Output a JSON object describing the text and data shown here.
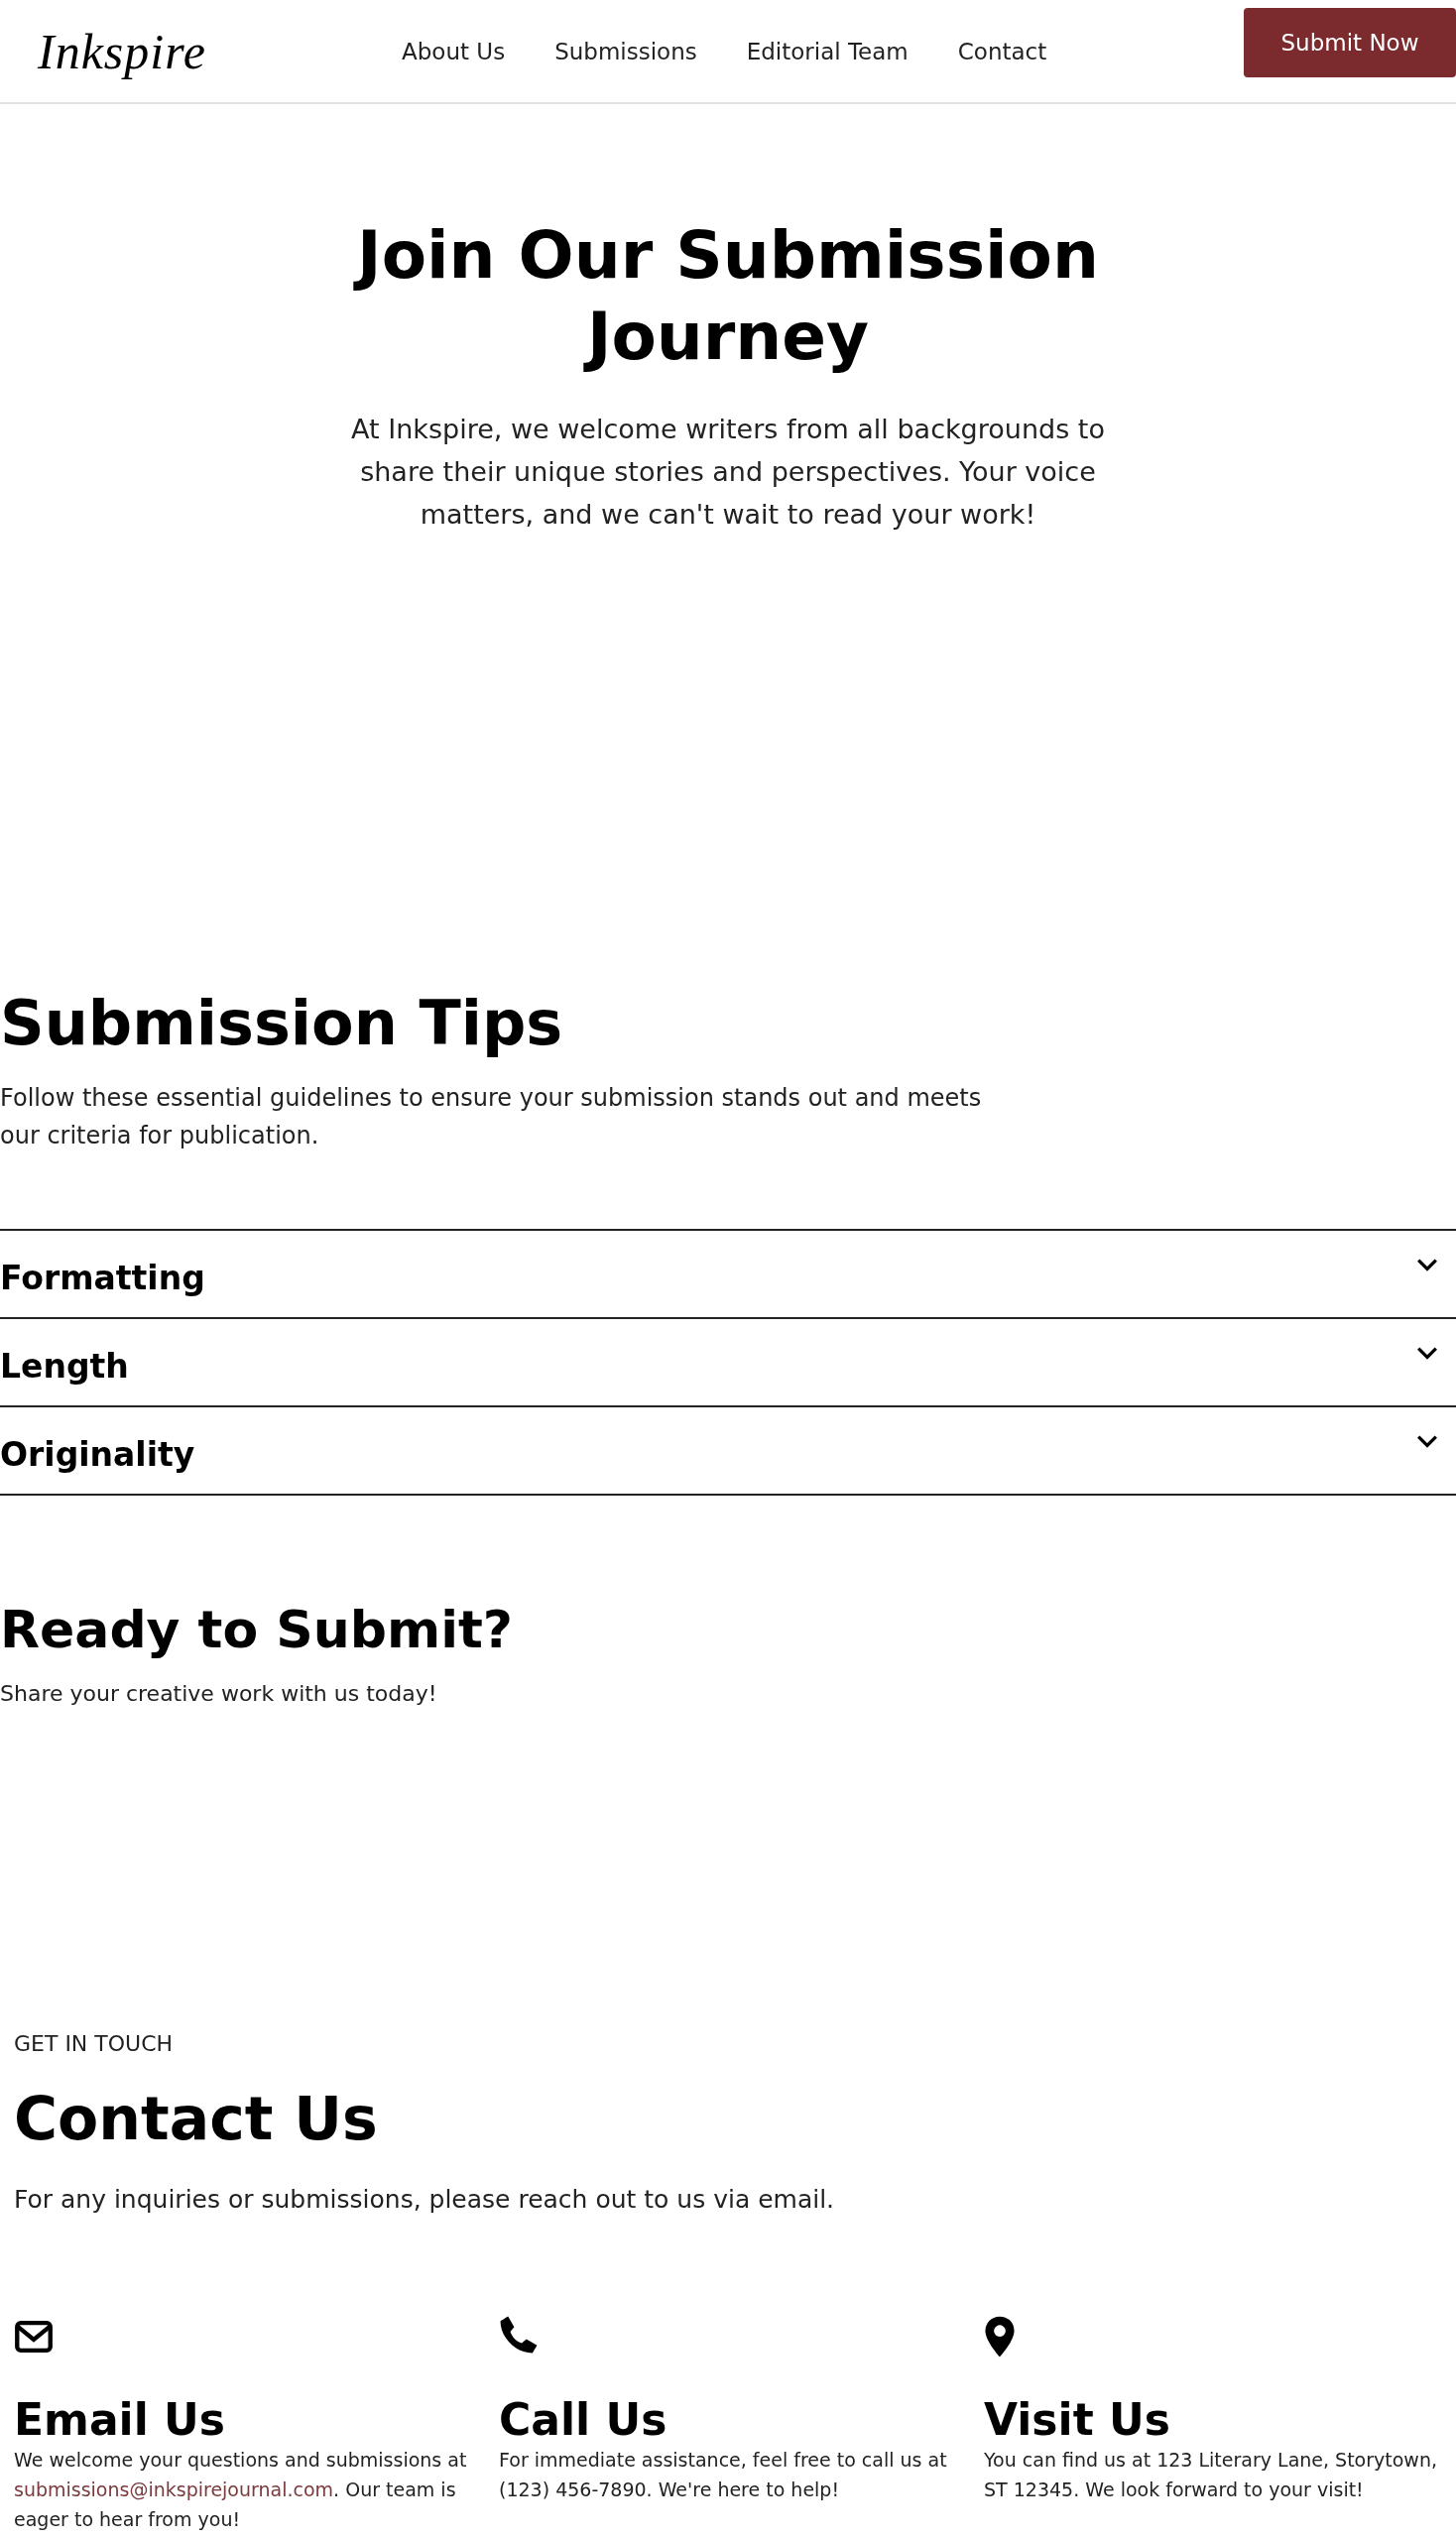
{
  "header": {
    "logo": "Inkspire",
    "nav": [
      "About Us",
      "Submissions",
      "Editorial Team",
      "Contact"
    ],
    "cta": "Submit Now"
  },
  "hero": {
    "title": "Join Our Submission Journey",
    "text": "At Inkspire, we welcome writers from all backgrounds to share their unique stories and perspectives. Your voice matters, and we can't wait to read your work!"
  },
  "tips": {
    "title": "Submission Tips",
    "text": "Follow these essential guidelines to ensure your submission stands out and meets our criteria for publication.",
    "items": [
      {
        "label": "Formatting",
        "expanded": false
      },
      {
        "label": "Length",
        "expanded": false
      },
      {
        "label": "Originality",
        "expanded": false
      }
    ]
  },
  "ready": {
    "title": "Ready to Submit?",
    "text": "Share your creative work with us today!"
  },
  "contact": {
    "eyebrow": "GET IN TOUCH",
    "title": "Contact Us",
    "text": "For any inquiries or submissions, please reach out to us via email.",
    "cards": [
      {
        "kind": "email",
        "title": "Email Us",
        "text_before": "We welcome your questions and submissions at ",
        "link": "submissions@inkspirejournal.com",
        "text_after": ". Our team is eager to hear from you!"
      },
      {
        "kind": "phone",
        "title": "Call Us",
        "text_before": "For immediate assistance, feel free to call us at (123) 456-7890. We're here to help!"
      },
      {
        "kind": "location",
        "title": "Visit Us",
        "text_before": "You can find us at 123 Literary Lane, Storytown, ST 12345. We look forward to your visit!"
      }
    ]
  }
}
